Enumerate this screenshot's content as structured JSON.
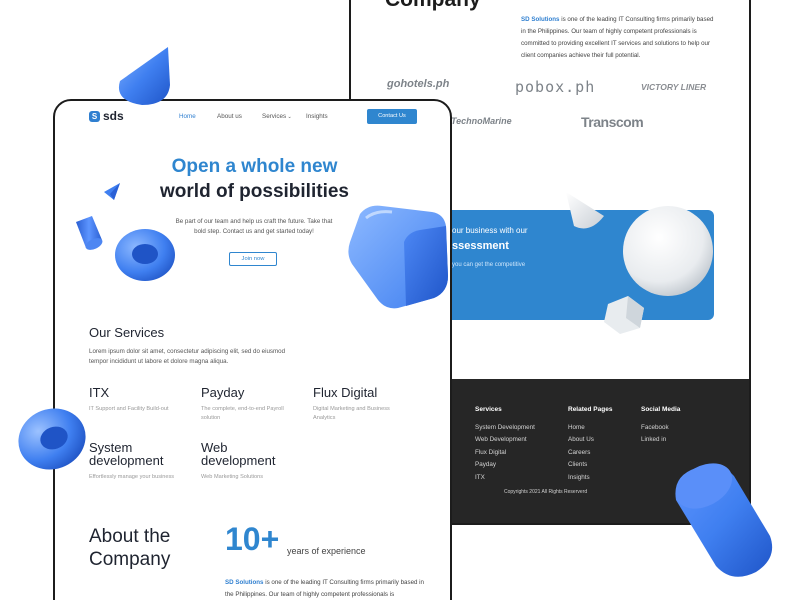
{
  "back_page": {
    "section_title": "Company",
    "about": {
      "highlight": "SD Solutions",
      "text": " is one of the leading IT Consulting firms primarily based in the Philippines. Our team of highly competent professionals is committed to providing excellent IT services and solutions to help our client companies achieve their full potential."
    },
    "client_logos": [
      "gohotels.ph",
      "pobox.ph",
      "VICTORY LINER",
      "TechnoMarine",
      "Transcom"
    ],
    "cta": {
      "line1": "our business with our",
      "line2": "ssessment",
      "line3": "you can get the competitive"
    },
    "footer": {
      "columns": [
        {
          "heading": "Services",
          "links": [
            "System Development",
            "Web Development",
            "Flux Digital",
            "Payday",
            "ITX"
          ]
        },
        {
          "heading": "Related Pages",
          "links": [
            "Home",
            "About Us",
            "Careers",
            "Clients",
            "Insights"
          ]
        },
        {
          "heading": "Social Media",
          "links": [
            "Facebook",
            "Linked in"
          ]
        }
      ],
      "copyright": "Copyrights 2021 All Rights Reserverd"
    }
  },
  "front_page": {
    "logo_text": "sds",
    "nav": {
      "items": [
        "Home",
        "About us",
        "Services",
        "Insights"
      ],
      "active": "Home",
      "contact_label": "Contact Us"
    },
    "hero": {
      "line1": "Open a whole new",
      "line2": "world of possibilities",
      "subtitle": "Be part of our team and help us craft the future. Take that bold step. Contact us and get started today!",
      "cta_label": "Join now"
    },
    "services": {
      "title": "Our Services",
      "description": "Lorem ipsum dolor sit amet, consectetur adipiscing elit, sed do eiusmod tempor incididunt ut labore et dolore magna aliqua.",
      "items": [
        {
          "name": "ITX",
          "desc": "IT Support and Facility Build-out"
        },
        {
          "name": "Payday",
          "desc": "The complete, end-to-end Payroll solution"
        },
        {
          "name": "Flux Digital",
          "desc": "Digital Marketing and Business Analytics"
        },
        {
          "name": "System development",
          "desc": "Effortlessly manage your business"
        },
        {
          "name": "Web development",
          "desc": "Web Marketing Solutions"
        }
      ]
    },
    "about": {
      "title": "About the Company",
      "years_number": "10+",
      "years_label": "years of experience",
      "highlight": "SD Solutions",
      "text": " is one of the leading IT Consulting firms primarily based in the Philippines. Our team of highly competent professionals is"
    }
  },
  "colors": {
    "accent": "#2f86cf",
    "dark": "#262626",
    "shape_blue": "#3f7ff0"
  },
  "icons": [
    "cone-shape",
    "torus-shape",
    "cube-shape",
    "cylinder-shape",
    "sphere-shape",
    "chevron-down-icon"
  ]
}
